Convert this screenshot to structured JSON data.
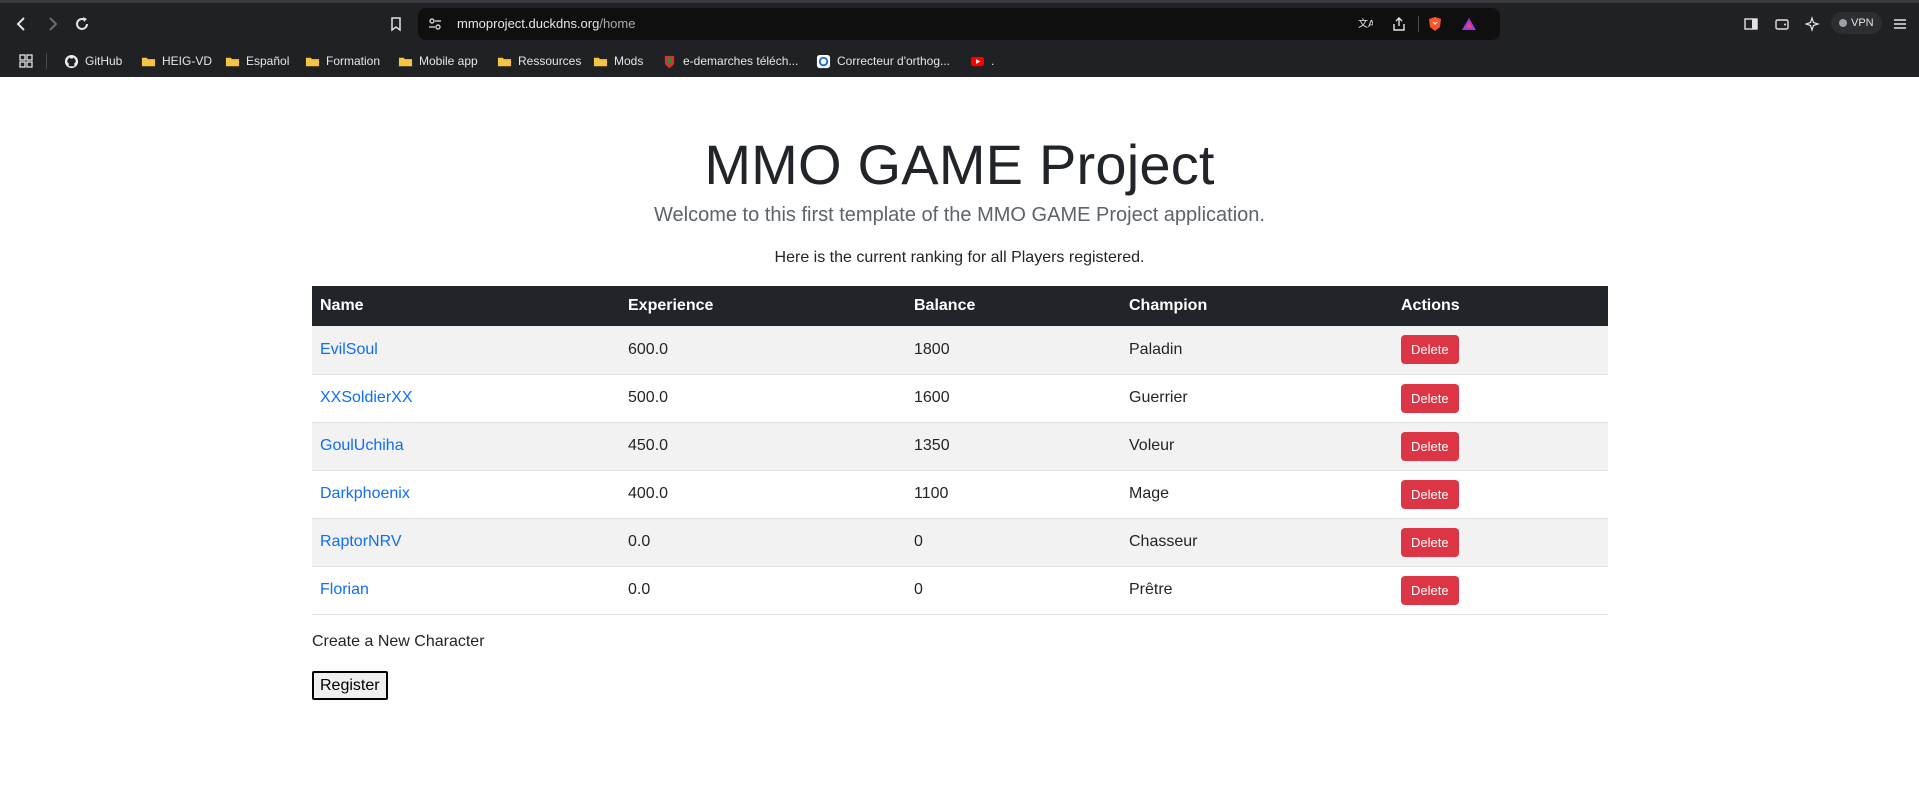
{
  "browser": {
    "url_host": "mmoproject.duckdns.org",
    "url_path": "/home",
    "vpn_label": "VPN",
    "bookmarks": [
      {
        "label": "GitHub",
        "icon": "github-icon"
      },
      {
        "label": "HEIG-VD",
        "icon": "folder-icon"
      },
      {
        "label": "Español",
        "icon": "folder-icon"
      },
      {
        "label": "Formation",
        "icon": "folder-icon"
      },
      {
        "label": "Mobile app",
        "icon": "folder-icon"
      },
      {
        "label": "Ressources",
        "icon": "folder-icon"
      },
      {
        "label": "Mods",
        "icon": "folder-icon"
      },
      {
        "label": "e-demarches téléch...",
        "icon": "site-icon"
      },
      {
        "label": "Correcteur d'orthog...",
        "icon": "site-icon"
      },
      {
        "label": ".",
        "icon": "youtube-icon"
      }
    ]
  },
  "page": {
    "title": "MMO GAME Project",
    "lead": "Welcome to this first template of the MMO GAME Project application.",
    "intro": "Here is the current ranking for all Players registered.",
    "table": {
      "headers": [
        "Name",
        "Experience",
        "Balance",
        "Champion",
        "Actions"
      ],
      "rows": [
        {
          "name": "EvilSoul",
          "experience": "600.0",
          "balance": "1800",
          "champion": "Paladin"
        },
        {
          "name": "XXSoldierXX",
          "experience": "500.0",
          "balance": "1600",
          "champion": "Guerrier"
        },
        {
          "name": "GoulUchiha",
          "experience": "450.0",
          "balance": "1350",
          "champion": "Voleur"
        },
        {
          "name": "Darkphoenix",
          "experience": "400.0",
          "balance": "1100",
          "champion": "Mage"
        },
        {
          "name": "RaptorNRV",
          "experience": "0.0",
          "balance": "0",
          "champion": "Chasseur"
        },
        {
          "name": "Florian",
          "experience": "0.0",
          "balance": "0",
          "champion": "Prêtre"
        }
      ],
      "delete_label": "Delete"
    },
    "create_label": "Create a New Character",
    "register_label": "Register"
  },
  "colors": {
    "chrome_bg": "#202124",
    "table_header_bg": "#212529",
    "link": "#0d6efd",
    "danger": "#dc3545",
    "stripe": "#f2f2f2"
  }
}
